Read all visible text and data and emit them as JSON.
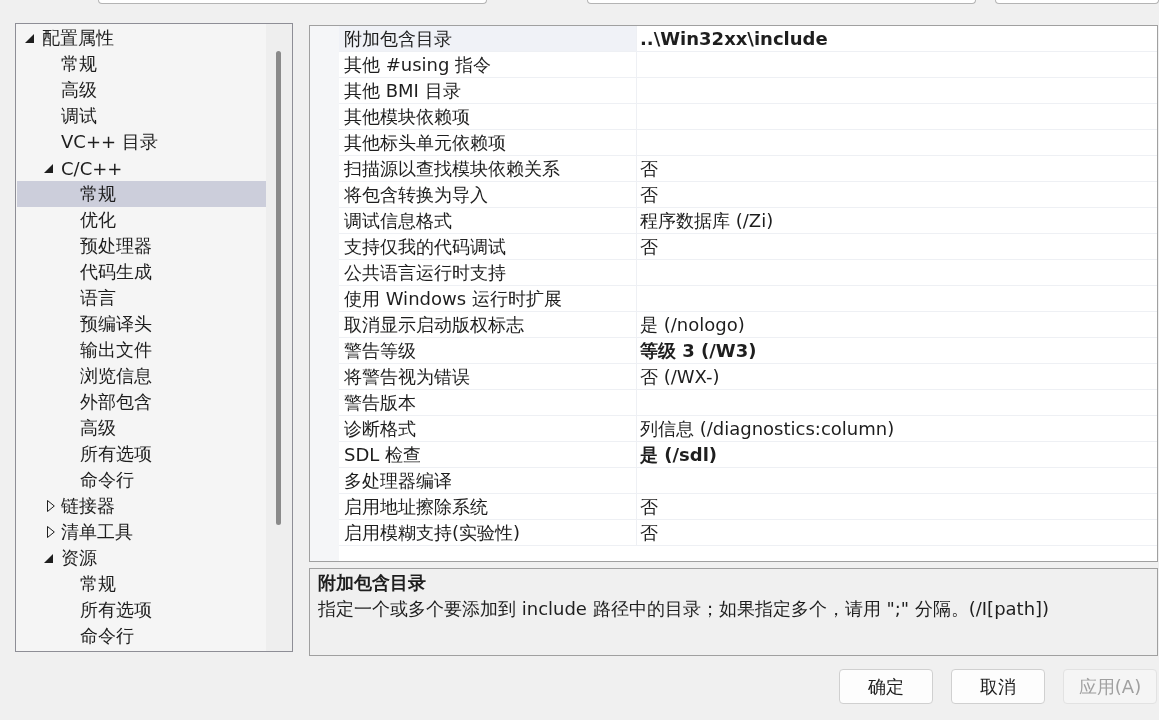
{
  "tree": [
    {
      "label": "配置属性",
      "expanded": true,
      "selected": false,
      "children": [
        {
          "label": "常规",
          "selected": false
        },
        {
          "label": "高级",
          "selected": false
        },
        {
          "label": "调试",
          "selected": false
        },
        {
          "label": "VC++ 目录",
          "selected": false
        },
        {
          "label": "C/C++",
          "expanded": true,
          "selected": false,
          "children": [
            {
              "label": "常规",
              "selected": true
            },
            {
              "label": "优化",
              "selected": false
            },
            {
              "label": "预处理器",
              "selected": false
            },
            {
              "label": "代码生成",
              "selected": false
            },
            {
              "label": "语言",
              "selected": false
            },
            {
              "label": "预编译头",
              "selected": false
            },
            {
              "label": "输出文件",
              "selected": false
            },
            {
              "label": "浏览信息",
              "selected": false
            },
            {
              "label": "外部包含",
              "selected": false
            },
            {
              "label": "高级",
              "selected": false
            },
            {
              "label": "所有选项",
              "selected": false
            },
            {
              "label": "命令行",
              "selected": false
            }
          ]
        },
        {
          "label": "链接器",
          "expanded": false,
          "selected": false
        },
        {
          "label": "清单工具",
          "expanded": false,
          "selected": false
        },
        {
          "label": "资源",
          "expanded": true,
          "selected": false,
          "children": [
            {
              "label": "常规",
              "selected": false
            },
            {
              "label": "所有选项",
              "selected": false
            },
            {
              "label": "命令行",
              "selected": false
            }
          ]
        }
      ]
    }
  ],
  "properties": [
    {
      "name": "附加包含目录",
      "value": "..\\Win32xx\\include",
      "modified": true,
      "selected": true
    },
    {
      "name": "其他 #using 指令",
      "selected": false
    },
    {
      "name": "其他 BMI 目录",
      "selected": false
    },
    {
      "name": "其他模块依赖项",
      "selected": false
    },
    {
      "name": "其他标头单元依赖项",
      "selected": false
    },
    {
      "name": "扫描源以查找模块依赖关系",
      "value": "否",
      "modified": false,
      "selected": false
    },
    {
      "name": "将包含转换为导入",
      "value": "否",
      "modified": false,
      "selected": false
    },
    {
      "name": "调试信息格式",
      "value": "程序数据库 (/Zi)",
      "modified": false,
      "selected": false
    },
    {
      "name": "支持仅我的代码调试",
      "value": "否",
      "modified": false,
      "selected": false
    },
    {
      "name": "公共语言运行时支持",
      "selected": false
    },
    {
      "name": "使用 Windows 运行时扩展",
      "selected": false
    },
    {
      "name": "取消显示启动版权标志",
      "value": "是 (/nologo)",
      "modified": false,
      "selected": false
    },
    {
      "name": "警告等级",
      "value": "等级 3 (/W3)",
      "modified": true,
      "selected": false
    },
    {
      "name": "将警告视为错误",
      "value": "否 (/WX-)",
      "modified": false,
      "selected": false
    },
    {
      "name": "警告版本",
      "selected": false
    },
    {
      "name": "诊断格式",
      "value": "列信息 (/diagnostics:column)",
      "modified": false,
      "selected": false
    },
    {
      "name": "SDL 检查",
      "value": "是 (/sdl)",
      "modified": true,
      "selected": false
    },
    {
      "name": "多处理器编译",
      "selected": false
    },
    {
      "name": "启用地址擦除系统",
      "value": "否",
      "modified": false,
      "selected": false
    },
    {
      "name": "启用模糊支持(实验性)",
      "value": "否",
      "modified": false,
      "selected": false
    }
  ],
  "description": {
    "title": "附加包含目录",
    "text": "指定一个或多个要添加到 include 路径中的目录；如果指定多个，请用 \";\" 分隔。(/I[path])"
  },
  "buttons": [
    {
      "label": "确定",
      "disabled": false
    },
    {
      "label": "取消",
      "disabled": false
    },
    {
      "label": "应用(A)",
      "disabled": true
    }
  ]
}
